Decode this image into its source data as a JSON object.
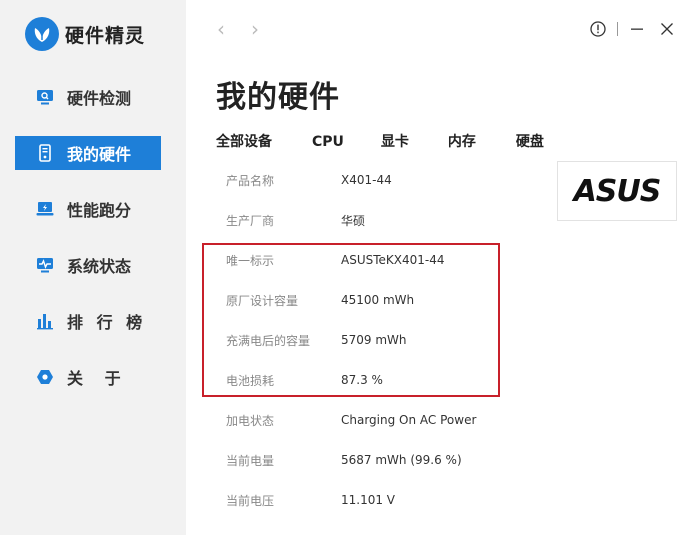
{
  "app": {
    "title": "硬件精灵"
  },
  "sidebar": {
    "items": [
      {
        "label": "硬件检测",
        "icon": "monitor-search-icon",
        "active": false
      },
      {
        "label": "我的硬件",
        "icon": "phone-device-icon",
        "active": true
      },
      {
        "label": "性能跑分",
        "icon": "laptop-bolt-icon",
        "active": false
      },
      {
        "label": "系统状态",
        "icon": "pulse-monitor-icon",
        "active": false
      },
      {
        "label": "排 行 榜",
        "icon": "bar-chart-icon",
        "active": false
      },
      {
        "label": "关 于",
        "icon": "hexagon-icon",
        "active": false
      }
    ]
  },
  "main": {
    "title": "我的硬件",
    "tabs": [
      "全部设备",
      "CPU",
      "显卡",
      "内存",
      "硬盘"
    ],
    "rows": [
      {
        "label": "产品名称",
        "value": "X401-44"
      },
      {
        "label": "生产厂商",
        "value": "华硕"
      },
      {
        "label": "唯一标示",
        "value": "ASUSTeKX401-44"
      },
      {
        "label": "原厂设计容量",
        "value": "45100 mWh"
      },
      {
        "label": "充满电后的容量",
        "value": "5709 mWh"
      },
      {
        "label": "电池损耗",
        "value": "87.3 %"
      },
      {
        "label": "加电状态",
        "value": "Charging On AC Power"
      },
      {
        "label": "当前电量",
        "value": "5687 mWh (99.6 %)"
      },
      {
        "label": "当前电压",
        "value": "11.101 V"
      }
    ],
    "brand": "ASUS"
  },
  "colors": {
    "accent": "#1e7fd8",
    "highlight": "#c8202a",
    "sidebar_bg": "#f2f2f2"
  }
}
